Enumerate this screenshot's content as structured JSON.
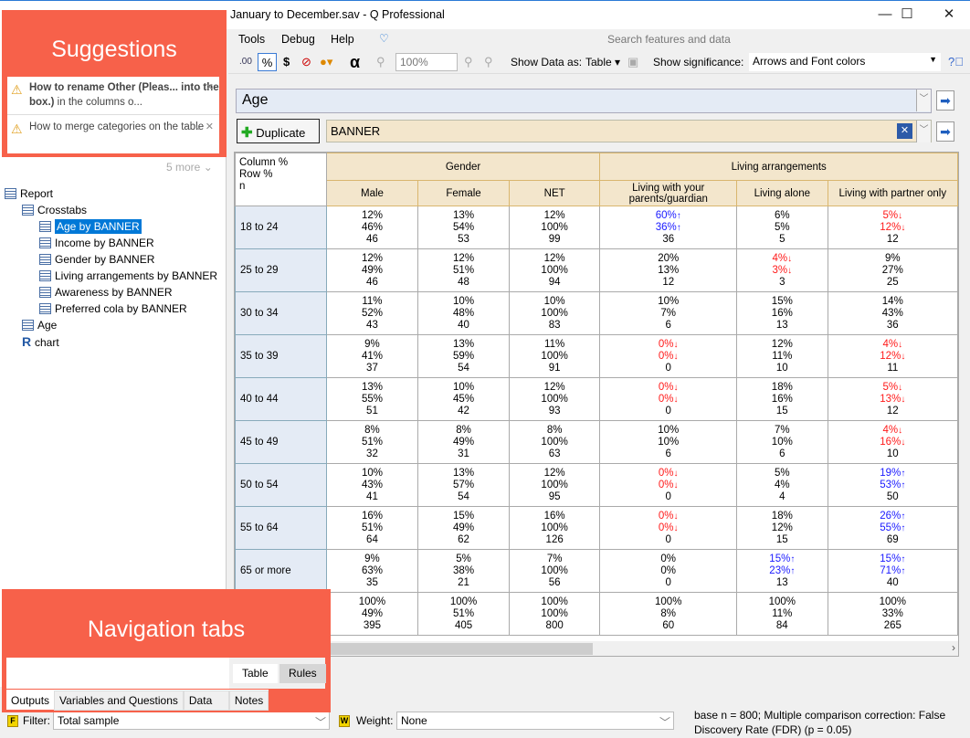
{
  "window": {
    "title": "January to December.sav - Q Professional"
  },
  "menu": [
    "Tools",
    "Debug",
    "Help"
  ],
  "search_placeholder": "Search features and data",
  "toolbar": {
    "zoom": "100%",
    "show_data_label": "Show Data as:",
    "show_data_value": "Table",
    "show_sig_label": "Show significance:",
    "show_sig_value": "Arrows and Font colors",
    "alpha": "α",
    "percent": "%",
    "dollar": "$"
  },
  "overlays": {
    "suggestions": "Suggestions",
    "navigation": "Navigation tabs"
  },
  "suggestions": [
    {
      "bold": "How to rename Other (Pleas... into the box.)",
      "text": " in the columns o..."
    },
    {
      "bold": "",
      "text": "How to merge categories on the table"
    }
  ],
  "more": "5 more",
  "tree": [
    {
      "label": "Report",
      "level": 0
    },
    {
      "label": "Crosstabs",
      "level": 1
    },
    {
      "label": "Age by BANNER",
      "level": 2,
      "selected": true
    },
    {
      "label": "Income by BANNER",
      "level": 2
    },
    {
      "label": "Gender by BANNER",
      "level": 2
    },
    {
      "label": "Living arrangements by BANNER",
      "level": 2
    },
    {
      "label": "Awareness by BANNER",
      "level": 2
    },
    {
      "label": "Preferred cola by BANNER",
      "level": 2
    },
    {
      "label": "Age",
      "level": 1
    },
    {
      "label": "chart",
      "level": 1
    }
  ],
  "rows_question": "Age",
  "duplicate_label": "Duplicate",
  "columns_question": "BANNER",
  "table": {
    "corner": [
      "Column %",
      "Row %",
      "n"
    ],
    "groups": [
      {
        "label": "Gender",
        "span": 3
      },
      {
        "label": "Living arrangements",
        "span": 3
      }
    ],
    "columns": [
      "Male",
      "Female",
      "NET",
      "Living with your parents/guardian",
      "Living alone",
      "Living with partner only"
    ],
    "rows": [
      {
        "label": "18 to 24",
        "cells": [
          {
            "v": [
              "12%",
              "46%",
              "46"
            ]
          },
          {
            "v": [
              "13%",
              "54%",
              "53"
            ]
          },
          {
            "v": [
              "12%",
              "100%",
              "99"
            ]
          },
          {
            "v": [
              "60%",
              "36%",
              "36"
            ],
            "sig": "up"
          },
          {
            "v": [
              "6%",
              "5%",
              "5"
            ]
          },
          {
            "v": [
              "5%",
              "12%",
              "12"
            ],
            "sig": "down"
          }
        ]
      },
      {
        "label": "25 to 29",
        "cells": [
          {
            "v": [
              "12%",
              "49%",
              "46"
            ]
          },
          {
            "v": [
              "12%",
              "51%",
              "48"
            ]
          },
          {
            "v": [
              "12%",
              "100%",
              "94"
            ]
          },
          {
            "v": [
              "20%",
              "13%",
              "12"
            ]
          },
          {
            "v": [
              "4%",
              "3%",
              "3"
            ],
            "sig": "down"
          },
          {
            "v": [
              "9%",
              "27%",
              "25"
            ]
          }
        ]
      },
      {
        "label": "30 to 34",
        "cells": [
          {
            "v": [
              "11%",
              "52%",
              "43"
            ]
          },
          {
            "v": [
              "10%",
              "48%",
              "40"
            ]
          },
          {
            "v": [
              "10%",
              "100%",
              "83"
            ]
          },
          {
            "v": [
              "10%",
              "7%",
              "6"
            ]
          },
          {
            "v": [
              "15%",
              "16%",
              "13"
            ]
          },
          {
            "v": [
              "14%",
              "43%",
              "36"
            ]
          }
        ]
      },
      {
        "label": "35 to 39",
        "cells": [
          {
            "v": [
              "9%",
              "41%",
              "37"
            ]
          },
          {
            "v": [
              "13%",
              "59%",
              "54"
            ]
          },
          {
            "v": [
              "11%",
              "100%",
              "91"
            ]
          },
          {
            "v": [
              "0%",
              "0%",
              "0"
            ],
            "sig": "down"
          },
          {
            "v": [
              "12%",
              "11%",
              "10"
            ]
          },
          {
            "v": [
              "4%",
              "12%",
              "11"
            ],
            "sig": "down"
          }
        ]
      },
      {
        "label": "40 to 44",
        "cells": [
          {
            "v": [
              "13%",
              "55%",
              "51"
            ]
          },
          {
            "v": [
              "10%",
              "45%",
              "42"
            ]
          },
          {
            "v": [
              "12%",
              "100%",
              "93"
            ]
          },
          {
            "v": [
              "0%",
              "0%",
              "0"
            ],
            "sig": "down"
          },
          {
            "v": [
              "18%",
              "16%",
              "15"
            ]
          },
          {
            "v": [
              "5%",
              "13%",
              "12"
            ],
            "sig": "down"
          }
        ]
      },
      {
        "label": "45 to 49",
        "cells": [
          {
            "v": [
              "8%",
              "51%",
              "32"
            ]
          },
          {
            "v": [
              "8%",
              "49%",
              "31"
            ]
          },
          {
            "v": [
              "8%",
              "100%",
              "63"
            ]
          },
          {
            "v": [
              "10%",
              "10%",
              "6"
            ]
          },
          {
            "v": [
              "7%",
              "10%",
              "6"
            ]
          },
          {
            "v": [
              "4%",
              "16%",
              "10"
            ],
            "sig": "down"
          }
        ]
      },
      {
        "label": "50 to 54",
        "cells": [
          {
            "v": [
              "10%",
              "43%",
              "41"
            ]
          },
          {
            "v": [
              "13%",
              "57%",
              "54"
            ]
          },
          {
            "v": [
              "12%",
              "100%",
              "95"
            ]
          },
          {
            "v": [
              "0%",
              "0%",
              "0"
            ],
            "sig": "down"
          },
          {
            "v": [
              "5%",
              "4%",
              "4"
            ]
          },
          {
            "v": [
              "19%",
              "53%",
              "50"
            ],
            "sig": "up"
          }
        ]
      },
      {
        "label": "55 to 64",
        "cells": [
          {
            "v": [
              "16%",
              "51%",
              "64"
            ]
          },
          {
            "v": [
              "15%",
              "49%",
              "62"
            ]
          },
          {
            "v": [
              "16%",
              "100%",
              "126"
            ]
          },
          {
            "v": [
              "0%",
              "0%",
              "0"
            ],
            "sig": "down"
          },
          {
            "v": [
              "18%",
              "12%",
              "15"
            ]
          },
          {
            "v": [
              "26%",
              "55%",
              "69"
            ],
            "sig": "up"
          }
        ]
      },
      {
        "label": "65 or more",
        "cells": [
          {
            "v": [
              "9%",
              "63%",
              "35"
            ]
          },
          {
            "v": [
              "5%",
              "38%",
              "21"
            ]
          },
          {
            "v": [
              "7%",
              "100%",
              "56"
            ]
          },
          {
            "v": [
              "0%",
              "0%",
              "0"
            ]
          },
          {
            "v": [
              "15%",
              "23%",
              "13"
            ],
            "sig": "up"
          },
          {
            "v": [
              "15%",
              "71%",
              "40"
            ],
            "sig": "up"
          }
        ]
      },
      {
        "label": "",
        "cells": [
          {
            "v": [
              "100%",
              "49%",
              "395"
            ]
          },
          {
            "v": [
              "100%",
              "51%",
              "405"
            ]
          },
          {
            "v": [
              "100%",
              "100%",
              "800"
            ]
          },
          {
            "v": [
              "100%",
              "8%",
              "60"
            ]
          },
          {
            "v": [
              "100%",
              "11%",
              "84"
            ]
          },
          {
            "v": [
              "100%",
              "33%",
              "265"
            ]
          }
        ]
      }
    ]
  },
  "colors": {
    "sig_up": "#1a1aff",
    "sig_down": "#ff1a1a",
    "overlay": "#f7614a",
    "header": "#f3e6cc",
    "row_label": "#e4ebf5"
  },
  "subtabs": [
    "Table",
    "Rules"
  ],
  "navtabs": [
    "Outputs",
    "Variables and Questions",
    "Data",
    "Notes"
  ],
  "status": {
    "filter_label": "Filter:",
    "filter_value": "Total sample",
    "weight_label": "Weight:",
    "weight_value": "None",
    "info": "base n = 800; Multiple comparison correction: False Discovery Rate (FDR) (p = 0.05)"
  }
}
